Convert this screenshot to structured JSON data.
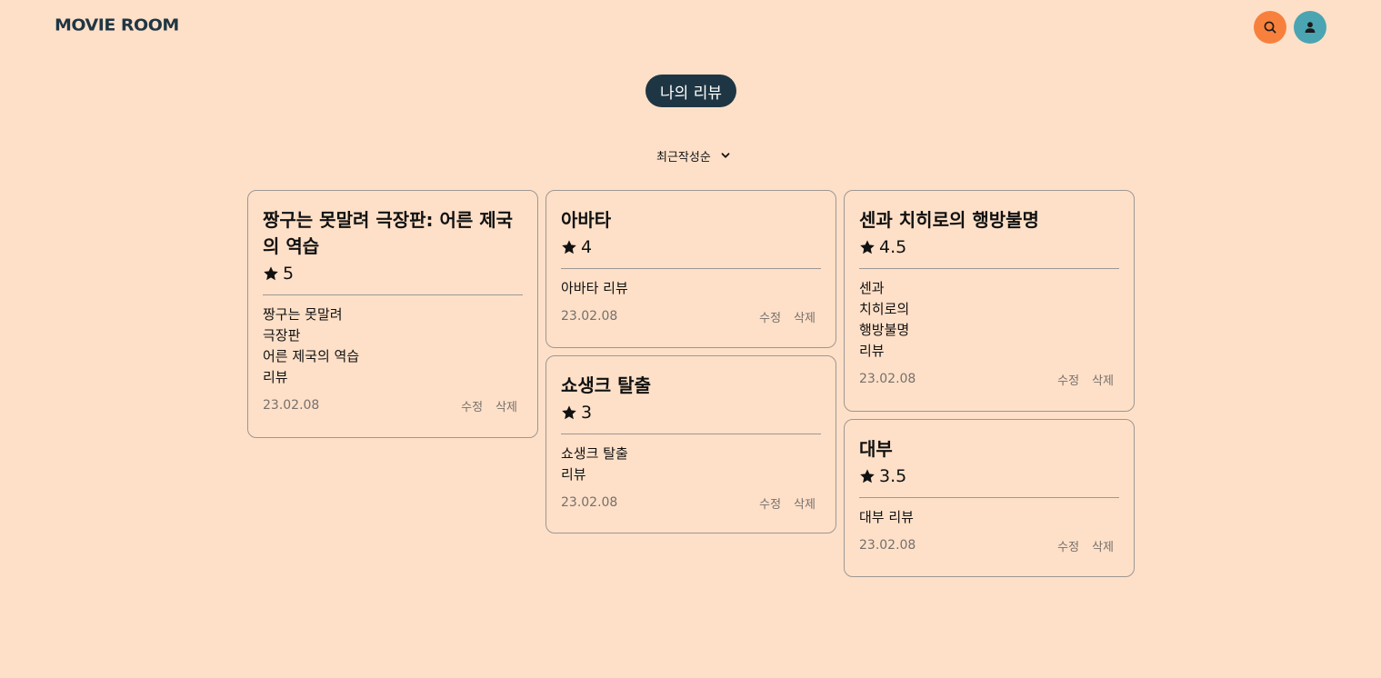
{
  "header": {
    "logo": "MOVIE ROOM"
  },
  "page": {
    "title": "나의 리뷰"
  },
  "sort": {
    "selected": "최근작성순"
  },
  "colors": {
    "background": "#fee0c8",
    "logo": "#1f3644",
    "search_button": "#f7813c",
    "profile_button": "#4ba4b1",
    "title_pill": "#1e3644"
  },
  "icons": {
    "search": "search-icon",
    "profile": "user-icon",
    "sort": "chevron-down-icon",
    "rating": "star-icon"
  },
  "reviews": [
    {
      "title": "짱구는 못말려 극장판: 어른 제국의 역습",
      "rating": "5",
      "body": "짱구는 못말려\n극장판\n어른 제국의 역습\n리뷰",
      "date": "23.02.08",
      "edit_label": "수정",
      "delete_label": "삭제"
    },
    {
      "title": "아바타",
      "rating": "4",
      "body": "아바타 리뷰",
      "date": "23.02.08",
      "edit_label": "수정",
      "delete_label": "삭제"
    },
    {
      "title": "쇼생크 탈출",
      "rating": "3",
      "body": "쇼생크 탈출\n리뷰",
      "date": "23.02.08",
      "edit_label": "수정",
      "delete_label": "삭제"
    },
    {
      "title": "센과 치히로의 행방불명",
      "rating": "4.5",
      "body": "센과\n치히로의\n행방불명\n리뷰",
      "date": "23.02.08",
      "edit_label": "수정",
      "delete_label": "삭제"
    },
    {
      "title": "대부",
      "rating": "3.5",
      "body": "대부 리뷰",
      "date": "23.02.08",
      "edit_label": "수정",
      "delete_label": "삭제"
    }
  ]
}
